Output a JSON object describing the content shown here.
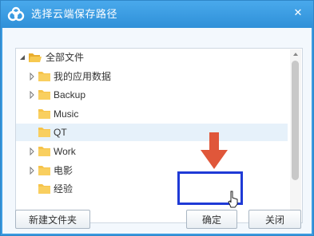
{
  "dialog": {
    "title": "选择云端保存路径",
    "close_glyph": "✕"
  },
  "tree": {
    "root": {
      "label": "全部文件",
      "expanded": true,
      "icon": "folder-open-icon"
    },
    "items": [
      {
        "label": "我的应用数据",
        "has_children": true,
        "selected": false
      },
      {
        "label": "Backup",
        "has_children": true,
        "selected": false
      },
      {
        "label": "Music",
        "has_children": false,
        "selected": false
      },
      {
        "label": "QT",
        "has_children": false,
        "selected": true
      },
      {
        "label": "Work",
        "has_children": true,
        "selected": false
      },
      {
        "label": "电影",
        "has_children": true,
        "selected": false
      },
      {
        "label": "经验",
        "has_children": false,
        "selected": false
      }
    ]
  },
  "buttons": {
    "new_folder": "新建文件夹",
    "ok": "确定",
    "close": "关闭"
  },
  "colors": {
    "titlebar": "#3a9be0",
    "folder": "#f6c34a",
    "selection": "#e6f1fa",
    "highlight_box": "#1f3ad6",
    "annotation_arrow": "#e0573a"
  }
}
